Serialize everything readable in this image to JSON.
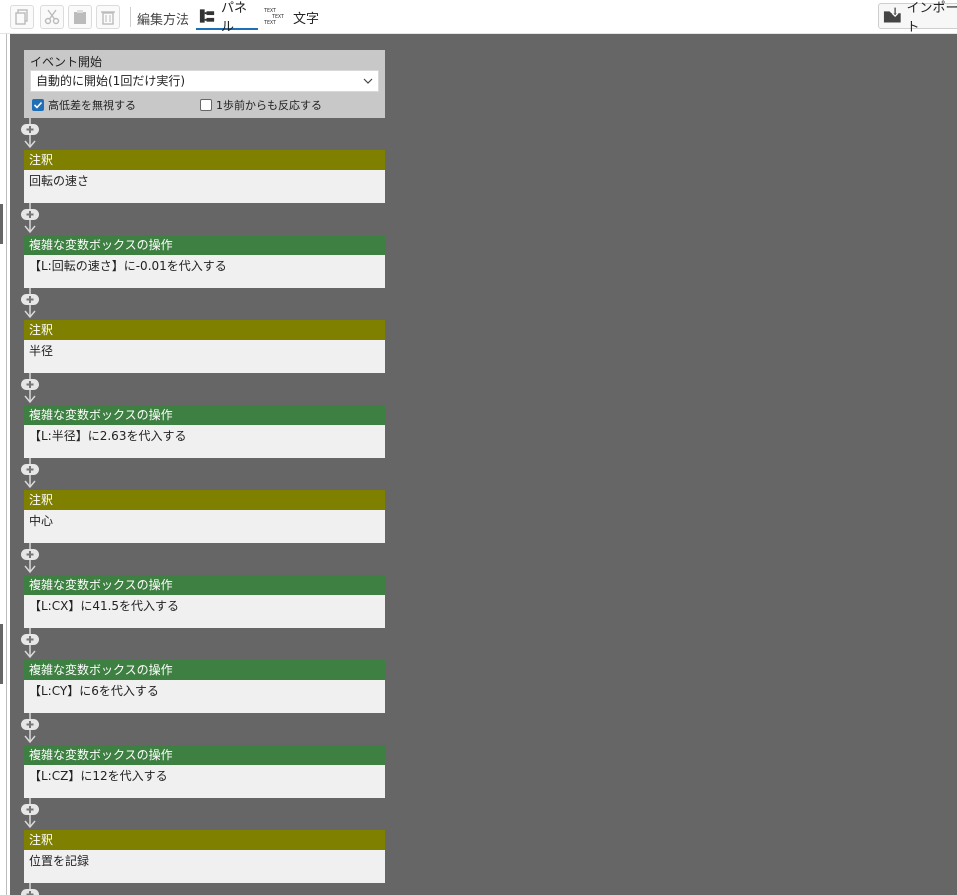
{
  "toolbar": {
    "edit_method_label": "編集方法",
    "mode_panel_label": "パネル",
    "mode_text_label": "文字",
    "text_icon_glyph": "TEXT",
    "import_label": "インポート"
  },
  "start_block": {
    "title": "イベント開始",
    "trigger_value": "自動的に開始(1回だけ実行)",
    "ignore_height_label": "高低差を無視する",
    "ignore_height_checked": true,
    "react_before_label": "1歩前からも反応する",
    "react_before_checked": false
  },
  "blocks": [
    {
      "type": "note",
      "header": "注釈",
      "body": "回転の速さ"
    },
    {
      "type": "op",
      "header": "複雑な変数ボックスの操作",
      "body": "【L:回転の速さ】に-0.01を代入する"
    },
    {
      "type": "note",
      "header": "注釈",
      "body": "半径"
    },
    {
      "type": "op",
      "header": "複雑な変数ボックスの操作",
      "body": "【L:半径】に2.63を代入する"
    },
    {
      "type": "note",
      "header": "注釈",
      "body": "中心"
    },
    {
      "type": "op",
      "header": "複雑な変数ボックスの操作",
      "body": "【L:CX】に41.5を代入する"
    },
    {
      "type": "op",
      "header": "複雑な変数ボックスの操作",
      "body": "【L:CY】に6を代入する"
    },
    {
      "type": "op",
      "header": "複雑な変数ボックスの操作",
      "body": "【L:CZ】に12を代入する"
    },
    {
      "type": "note",
      "header": "注釈",
      "body": "位置を記録"
    }
  ],
  "colors": {
    "note_header": "#808000",
    "op_header": "#3e7f42",
    "canvas_bg": "#666666",
    "accent": "#1f6fb6"
  }
}
